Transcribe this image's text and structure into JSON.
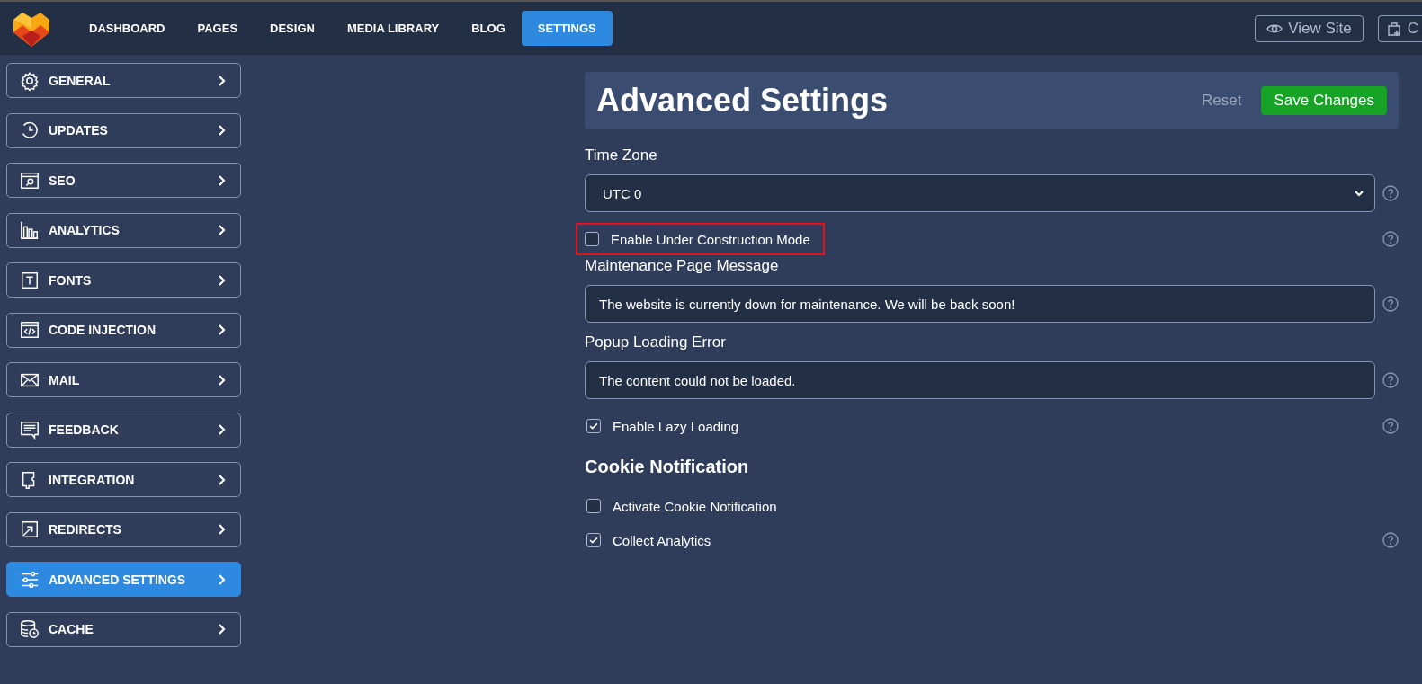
{
  "nav": {
    "items": [
      {
        "label": "DASHBOARD",
        "selected": false
      },
      {
        "label": "PAGES",
        "selected": false
      },
      {
        "label": "DESIGN",
        "selected": false
      },
      {
        "label": "MEDIA LIBRARY",
        "selected": false
      },
      {
        "label": "BLOG",
        "selected": false
      },
      {
        "label": "SETTINGS",
        "selected": true
      }
    ],
    "actions": [
      {
        "label": "View Site"
      },
      {
        "label": "C"
      }
    ]
  },
  "sidebar": {
    "items": [
      {
        "label": "GENERAL",
        "selected": false
      },
      {
        "label": "UPDATES",
        "selected": false
      },
      {
        "label": "SEO",
        "selected": false
      },
      {
        "label": "ANALYTICS",
        "selected": false
      },
      {
        "label": "FONTS",
        "selected": false
      },
      {
        "label": "CODE INJECTION",
        "selected": false
      },
      {
        "label": "MAIL",
        "selected": false
      },
      {
        "label": "FEEDBACK",
        "selected": false
      },
      {
        "label": "INTEGRATION",
        "selected": false
      },
      {
        "label": "REDIRECTS",
        "selected": false
      },
      {
        "label": "ADVANCED SETTINGS",
        "selected": true
      },
      {
        "label": "CACHE",
        "selected": false
      }
    ]
  },
  "panel": {
    "title": "Advanced Settings",
    "reset": "Reset",
    "save": "Save Changes",
    "fields": [
      {
        "kind": "select",
        "label": "Time Zone",
        "value": "UTC 0",
        "help": true
      },
      {
        "kind": "checkbox",
        "label": "Enable Under Construction Mode",
        "checked": false,
        "highlighted": true,
        "help": true
      },
      {
        "kind": "text",
        "label": "Maintenance Page Message",
        "value": "The website is currently down for maintenance. We will be back soon!",
        "help": true
      },
      {
        "kind": "text",
        "label": "Popup Loading Error",
        "value": "The content could not be loaded.",
        "help": true
      },
      {
        "kind": "checkbox",
        "label": "Enable Lazy Loading",
        "checked": true,
        "highlighted": false,
        "help": true
      },
      {
        "kind": "heading",
        "label": "Cookie Notification"
      },
      {
        "kind": "checkbox",
        "label": "Activate Cookie Notification",
        "checked": false,
        "highlighted": false,
        "help": false
      },
      {
        "kind": "checkbox",
        "label": "Collect Analytics",
        "checked": true,
        "highlighted": false,
        "help": true
      }
    ]
  }
}
